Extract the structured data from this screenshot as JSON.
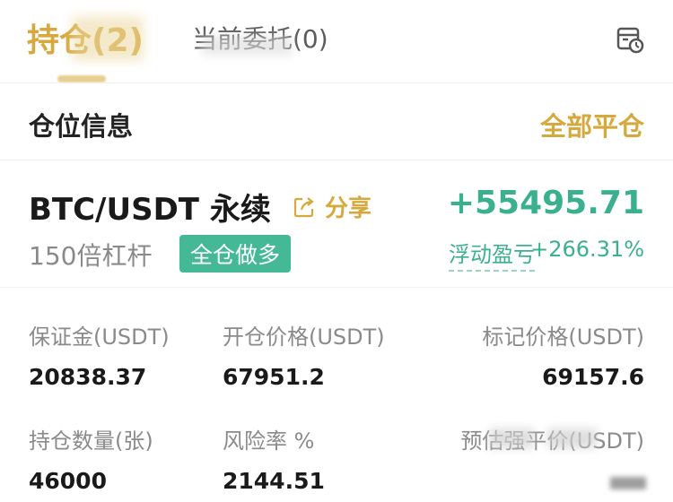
{
  "tabs": {
    "positions": "持仓(2)",
    "orders": "当前委托(0)"
  },
  "section": {
    "title": "仓位信息",
    "close_all": "全部平仓"
  },
  "position": {
    "pair": "BTC/USDT 永续",
    "share": "分享",
    "pnl": "+55495.71",
    "leverage": "150倍杠杆",
    "mode_badge": "全仓做多",
    "float_label": "浮动盈亏",
    "float_pct": "+266.31%"
  },
  "stats": {
    "margin_label": "保证金(USDT)",
    "margin_value": "20838.37",
    "open_price_label": "开仓价格(USDT)",
    "open_price_value": "67951.2",
    "mark_price_label": "标记价格(USDT)",
    "mark_price_value": "69157.6",
    "qty_label": "持仓数量(张)",
    "qty_value": "46000",
    "risk_label": "风险率 %",
    "risk_value": "2144.51",
    "liq_label": "预估强平价(USDT)",
    "liq_value": ""
  },
  "colors": {
    "accent": "#d6a93e",
    "profit": "#3bb08f",
    "badge": "#45b896"
  },
  "icons": {
    "history": "calendar-clock-icon",
    "share": "share-icon"
  }
}
